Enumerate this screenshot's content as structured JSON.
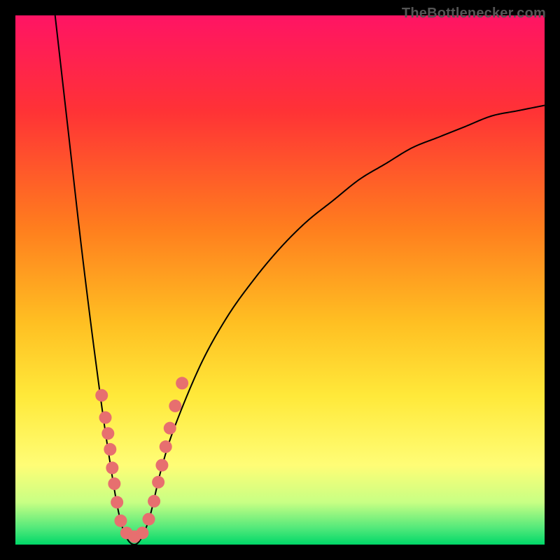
{
  "watermark": {
    "text": "TheBottlenecker.com",
    "color": "#555555",
    "font_size_px": 20
  },
  "gradient": {
    "stops": [
      {
        "offset": 0.0,
        "color": "#ff1464"
      },
      {
        "offset": 0.18,
        "color": "#ff3236"
      },
      {
        "offset": 0.4,
        "color": "#ff7d1e"
      },
      {
        "offset": 0.58,
        "color": "#ffbf22"
      },
      {
        "offset": 0.72,
        "color": "#ffe93a"
      },
      {
        "offset": 0.85,
        "color": "#fffd76"
      },
      {
        "offset": 0.92,
        "color": "#c8ff84"
      },
      {
        "offset": 0.97,
        "color": "#4fe87a"
      },
      {
        "offset": 1.0,
        "color": "#00d868"
      }
    ]
  },
  "curve": {
    "stroke": "#000000",
    "stroke_width": 2.0
  },
  "markers": {
    "fill": "#e76f6f",
    "radius": 9,
    "positions_norm": [
      {
        "x": 0.163,
        "y": 0.718
      },
      {
        "x": 0.17,
        "y": 0.76
      },
      {
        "x": 0.175,
        "y": 0.79
      },
      {
        "x": 0.179,
        "y": 0.82
      },
      {
        "x": 0.183,
        "y": 0.855
      },
      {
        "x": 0.187,
        "y": 0.885
      },
      {
        "x": 0.192,
        "y": 0.92
      },
      {
        "x": 0.199,
        "y": 0.955
      },
      {
        "x": 0.21,
        "y": 0.978
      },
      {
        "x": 0.225,
        "y": 0.985
      },
      {
        "x": 0.24,
        "y": 0.978
      },
      {
        "x": 0.252,
        "y": 0.952
      },
      {
        "x": 0.262,
        "y": 0.918
      },
      {
        "x": 0.27,
        "y": 0.882
      },
      {
        "x": 0.277,
        "y": 0.85
      },
      {
        "x": 0.284,
        "y": 0.815
      },
      {
        "x": 0.292,
        "y": 0.78
      },
      {
        "x": 0.302,
        "y": 0.738
      },
      {
        "x": 0.315,
        "y": 0.695
      }
    ]
  },
  "chart_data": {
    "type": "line",
    "title": "",
    "xlabel": "",
    "ylabel": "",
    "xlim": [
      0,
      1
    ],
    "ylim": [
      0,
      1
    ],
    "note": "x and y are normalized plot-area coordinates; y is distance from top (0=top edge, 1=bottom/green). The curve is a V-shaped dip reaching the bottom near x≈0.225. Marker series highlights data points on both sides of the dip.",
    "series": [
      {
        "name": "bottleneck-curve",
        "x": [
          0.075,
          0.1,
          0.125,
          0.15,
          0.175,
          0.2,
          0.225,
          0.25,
          0.275,
          0.3,
          0.35,
          0.4,
          0.45,
          0.5,
          0.55,
          0.6,
          0.65,
          0.7,
          0.75,
          0.8,
          0.85,
          0.9,
          0.95,
          1.0
        ],
        "y": [
          0.0,
          0.22,
          0.44,
          0.64,
          0.82,
          0.96,
          1.0,
          0.96,
          0.86,
          0.78,
          0.66,
          0.57,
          0.5,
          0.44,
          0.39,
          0.35,
          0.31,
          0.28,
          0.25,
          0.23,
          0.21,
          0.19,
          0.18,
          0.17
        ]
      },
      {
        "name": "highlight-markers",
        "x": [
          0.163,
          0.17,
          0.175,
          0.179,
          0.183,
          0.187,
          0.192,
          0.199,
          0.21,
          0.225,
          0.24,
          0.252,
          0.262,
          0.27,
          0.277,
          0.284,
          0.292,
          0.302,
          0.315
        ],
        "y": [
          0.718,
          0.76,
          0.79,
          0.82,
          0.855,
          0.885,
          0.92,
          0.955,
          0.978,
          0.985,
          0.978,
          0.952,
          0.918,
          0.882,
          0.85,
          0.815,
          0.78,
          0.738,
          0.695
        ]
      }
    ]
  }
}
